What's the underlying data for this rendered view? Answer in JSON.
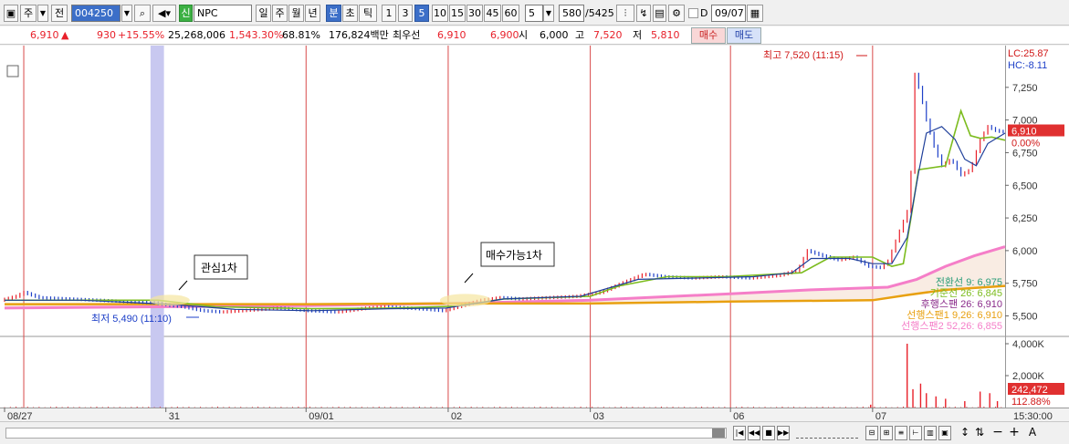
{
  "toolbar": {
    "mode1": "주",
    "mode2": "전",
    "code": "004250",
    "badge": "신",
    "name": "NPC",
    "periods": [
      "일",
      "주",
      "월",
      "년",
      "분",
      "초",
      "틱"
    ],
    "active_period": "분",
    "intervals": [
      "1",
      "3",
      "5",
      "10",
      "15",
      "30",
      "45",
      "60"
    ],
    "active_interval": "5",
    "interval_select": "5",
    "count": "580",
    "total": "/5425",
    "date_check_label": "D",
    "date": "09/07"
  },
  "quote": {
    "price": "6,910",
    "arrow": "▲",
    "change": "930",
    "change_pct": "+15.55%",
    "volume": "25,268,006",
    "volume_ratio": "1,543.30%",
    "turnover": "68.81%",
    "amount": "176,824백만",
    "best_label": "최우선",
    "ask": "6,910",
    "bid": "6,900",
    "open_label": "시",
    "open": "6,000",
    "high_label": "고",
    "high": "7,520",
    "low_label": "저",
    "low": "5,810",
    "buy_button": "매수",
    "sell_button": "매도"
  },
  "chart_data": {
    "type": "line",
    "price_axis": {
      "ylim": [
        5350,
        7500
      ],
      "ticks": [
        "7,250",
        "7,000",
        "6,750",
        "6,500",
        "6,250",
        "6,000",
        "5,750",
        "5,500"
      ],
      "tick_values": [
        7250,
        7000,
        6750,
        6500,
        6250,
        6000,
        5750,
        5500
      ]
    },
    "volume_axis": {
      "ylim": [
        0,
        4400000
      ],
      "ticks": [
        "4,000K",
        "2,000K"
      ],
      "tick_values": [
        4000000,
        2000000
      ]
    },
    "x_labels": [
      {
        "label": "08/27",
        "bar": 0
      },
      {
        "label": "31",
        "bar": 84
      },
      {
        "label": "09/01",
        "bar": 157
      },
      {
        "label": "02",
        "bar": 231
      },
      {
        "label": "03",
        "bar": 305
      },
      {
        "label": "06",
        "bar": 378
      },
      {
        "label": "07",
        "bar": 452
      }
    ],
    "time_label": "15:30:00",
    "bar_count": 522,
    "vertical_line_bars": [
      10,
      157,
      231,
      305,
      378,
      452
    ],
    "highlight_band_bars": [
      76,
      83
    ],
    "price_points": [
      [
        0,
        5620
      ],
      [
        8,
        5650
      ],
      [
        12,
        5680
      ],
      [
        20,
        5640
      ],
      [
        35,
        5630
      ],
      [
        50,
        5620
      ],
      [
        65,
        5610
      ],
      [
        80,
        5600
      ],
      [
        88,
        5580
      ],
      [
        95,
        5570
      ],
      [
        105,
        5540
      ],
      [
        115,
        5530
      ],
      [
        125,
        5540
      ],
      [
        135,
        5550
      ],
      [
        145,
        5560
      ],
      [
        160,
        5540
      ],
      [
        175,
        5530
      ],
      [
        190,
        5560
      ],
      [
        200,
        5570
      ],
      [
        212,
        5560
      ],
      [
        222,
        5550
      ],
      [
        230,
        5540
      ],
      [
        240,
        5580
      ],
      [
        250,
        5620
      ],
      [
        260,
        5640
      ],
      [
        270,
        5630
      ],
      [
        285,
        5640
      ],
      [
        300,
        5650
      ],
      [
        312,
        5680
      ],
      [
        325,
        5760
      ],
      [
        335,
        5820
      ],
      [
        345,
        5800
      ],
      [
        360,
        5790
      ],
      [
        375,
        5800
      ],
      [
        390,
        5790
      ],
      [
        405,
        5810
      ],
      [
        415,
        5850
      ],
      [
        420,
        6000
      ],
      [
        428,
        5960
      ],
      [
        436,
        5930
      ],
      [
        444,
        5950
      ],
      [
        452,
        5880
      ],
      [
        458,
        5870
      ],
      [
        462,
        5920
      ],
      [
        468,
        6150
      ],
      [
        472,
        6300
      ],
      [
        474,
        6600
      ],
      [
        476,
        7350
      ],
      [
        479,
        7200
      ],
      [
        482,
        7000
      ],
      [
        486,
        6800
      ],
      [
        490,
        6650
      ],
      [
        495,
        6700
      ],
      [
        500,
        6580
      ],
      [
        505,
        6620
      ],
      [
        510,
        6850
      ],
      [
        514,
        6950
      ],
      [
        518,
        6920
      ],
      [
        521,
        6910
      ]
    ],
    "series": [
      {
        "name": "전환선",
        "period": "9",
        "value": "6,975",
        "color": "#2a9d78",
        "points": [
          [
            0,
            5620
          ],
          [
            40,
            5620
          ],
          [
            85,
            5590
          ],
          [
            120,
            5550
          ],
          [
            160,
            5540
          ],
          [
            200,
            5555
          ],
          [
            230,
            5560
          ],
          [
            260,
            5630
          ],
          [
            300,
            5650
          ],
          [
            330,
            5780
          ],
          [
            360,
            5790
          ],
          [
            390,
            5800
          ],
          [
            410,
            5830
          ],
          [
            420,
            5940
          ],
          [
            440,
            5940
          ],
          [
            452,
            5900
          ],
          [
            462,
            5900
          ],
          [
            470,
            6100
          ],
          [
            476,
            6600
          ],
          [
            480,
            6900
          ],
          [
            488,
            6950
          ],
          [
            495,
            6850
          ],
          [
            500,
            6700
          ],
          [
            506,
            6650
          ],
          [
            512,
            6820
          ],
          [
            521,
            6900
          ]
        ]
      },
      {
        "name": "기준선",
        "period": "26",
        "value": "6,845",
        "color": "#7cbc1e",
        "points": [
          [
            0,
            5620
          ],
          [
            25,
            5620
          ],
          [
            80,
            5620
          ],
          [
            110,
            5570
          ],
          [
            160,
            5555
          ],
          [
            200,
            5560
          ],
          [
            235,
            5575
          ],
          [
            260,
            5630
          ],
          [
            305,
            5650
          ],
          [
            320,
            5730
          ],
          [
            345,
            5800
          ],
          [
            375,
            5800
          ],
          [
            415,
            5830
          ],
          [
            430,
            5950
          ],
          [
            452,
            5950
          ],
          [
            462,
            5880
          ],
          [
            468,
            5900
          ],
          [
            472,
            6250
          ],
          [
            476,
            6620
          ],
          [
            490,
            6650
          ],
          [
            498,
            7070
          ],
          [
            503,
            6880
          ],
          [
            508,
            6860
          ],
          [
            514,
            6870
          ],
          [
            521,
            6845
          ]
        ]
      },
      {
        "name": "후행스팬",
        "period": "26",
        "value": "6,910",
        "color": "#8a2a8a",
        "points": []
      },
      {
        "name": "선행스팬1",
        "period": "9,26",
        "value": "6,910",
        "color": "#e8a010",
        "points": [
          [
            0,
            5590
          ],
          [
            80,
            5590
          ],
          [
            160,
            5590
          ],
          [
            231,
            5595
          ],
          [
            305,
            5595
          ],
          [
            378,
            5610
          ],
          [
            452,
            5620
          ],
          [
            470,
            5660
          ],
          [
            490,
            5700
          ],
          [
            521,
            5730
          ]
        ]
      },
      {
        "name": "선행스팬2",
        "period": "52,26",
        "value": "6,855",
        "color": "#f57ec8",
        "points": [
          [
            0,
            5560
          ],
          [
            80,
            5570
          ],
          [
            160,
            5580
          ],
          [
            231,
            5595
          ],
          [
            305,
            5620
          ],
          [
            378,
            5670
          ],
          [
            420,
            5700
          ],
          [
            460,
            5720
          ],
          [
            475,
            5780
          ],
          [
            490,
            5880
          ],
          [
            505,
            5960
          ],
          [
            521,
            6030
          ]
        ]
      }
    ],
    "volume_spikes": [
      [
        451,
        180000
      ],
      [
        470,
        4000000
      ],
      [
        473,
        1150000
      ],
      [
        477,
        1500000
      ],
      [
        480,
        900000
      ],
      [
        485,
        700000
      ],
      [
        490,
        550000
      ],
      [
        500,
        400000
      ],
      [
        508,
        1000000
      ],
      [
        513,
        900000
      ],
      [
        517,
        400000
      ]
    ],
    "annotations": {
      "high_label": "최고 7,520 (11:15)",
      "low_label": "최저 5,490 (11:10)",
      "note1": "관심1차",
      "note2": "매수가능1차"
    },
    "right_top": {
      "lc": "LC:25.87",
      "hc": "HC:-8.11"
    },
    "current_price_tag": {
      "price": "6,910",
      "pct": "0.00%"
    },
    "volume_tag": {
      "value": "242,472",
      "pct": "112.88%"
    }
  }
}
